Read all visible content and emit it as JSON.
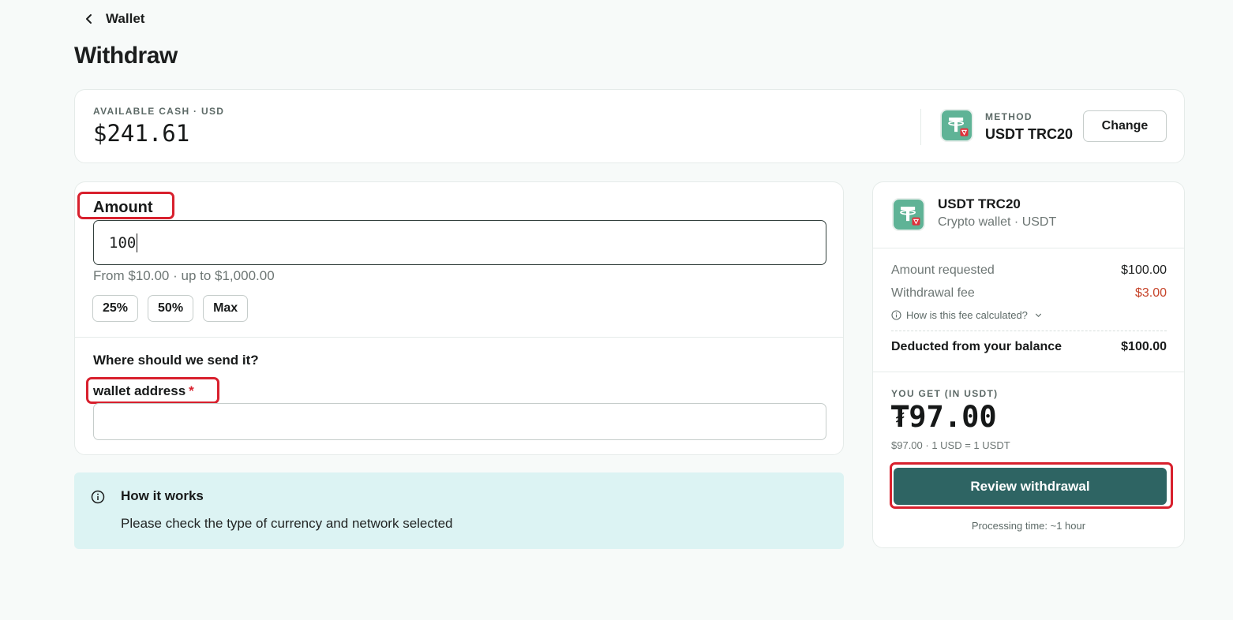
{
  "header": {
    "back_label": "Wallet",
    "title": "Withdraw"
  },
  "balance": {
    "label": "AVAILABLE CASH · USD",
    "value": "$241.61"
  },
  "method": {
    "label": "METHOD",
    "value": "USDT TRC20",
    "change_label": "Change",
    "icon": "usdt-tron-icon"
  },
  "form": {
    "amount_label": "Amount",
    "amount_value": "100",
    "range_hint": "From $10.00 · up to $1,000.00",
    "quick_amounts": [
      "25%",
      "50%",
      "Max"
    ],
    "destination_question": "Where should we send it?",
    "wallet_label": "wallet address",
    "required_mark": "*",
    "wallet_value": ""
  },
  "info": {
    "title": "How it works",
    "text": "Please check the type of currency and network selected"
  },
  "summary": {
    "method_name": "USDT TRC20",
    "method_sub": "Crypto wallet · USDT",
    "amount_requested_label": "Amount requested",
    "amount_requested_value": "$100.00",
    "fee_label": "Withdrawal fee",
    "fee_value": "$3.00",
    "fee_help": "How is this fee calculated?",
    "deducted_label": "Deducted from your balance",
    "deducted_value": "$100.00",
    "you_get_label": "YOU GET (IN USDT)",
    "you_get_value": "₮97.00",
    "you_get_sub": "$97.00 · 1 USD = 1 USDT",
    "review_label": "Review withdrawal",
    "processing_time": "Processing time: ~1 hour"
  },
  "colors": {
    "accent": "#2e6463",
    "highlight": "#d8202d",
    "fee": "#c6442a",
    "info_bg": "#dcf3f3"
  }
}
